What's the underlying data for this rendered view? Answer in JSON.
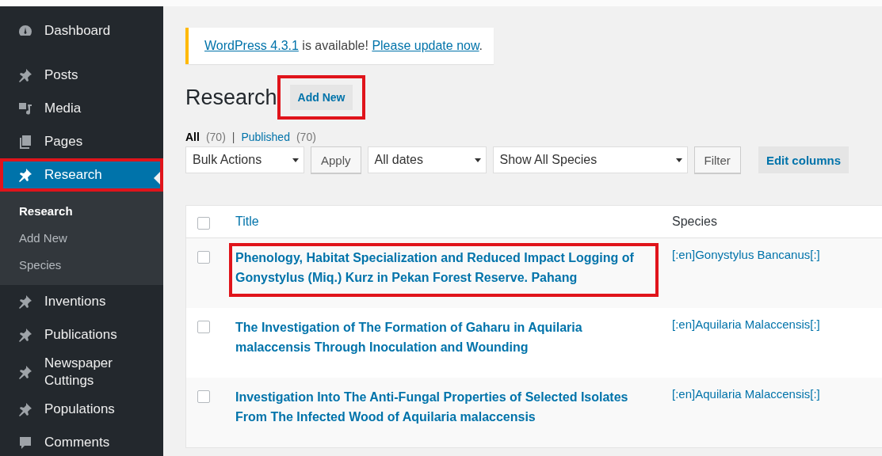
{
  "sidebar": {
    "items": [
      {
        "label": "Dashboard",
        "kind": "dashboard",
        "selected": false,
        "highlighted": false
      },
      {
        "label": "Posts",
        "kind": "pin",
        "selected": false,
        "highlighted": false
      },
      {
        "label": "Media",
        "kind": "media",
        "selected": false,
        "highlighted": false
      },
      {
        "label": "Pages",
        "kind": "pages",
        "selected": false,
        "highlighted": false
      },
      {
        "label": "Research",
        "kind": "pin",
        "selected": true,
        "highlighted": true,
        "submenu": [
          {
            "label": "Research",
            "selected": true
          },
          {
            "label": "Add New",
            "selected": false
          },
          {
            "label": "Species",
            "selected": false
          }
        ]
      },
      {
        "label": "Inventions",
        "kind": "pin",
        "selected": false,
        "highlighted": false
      },
      {
        "label": "Publications",
        "kind": "pin",
        "selected": false,
        "highlighted": false
      },
      {
        "label": "Newspaper Cuttings",
        "kind": "pin",
        "selected": false,
        "highlighted": false
      },
      {
        "label": "Populations",
        "kind": "pin",
        "selected": false,
        "highlighted": false
      },
      {
        "label": "Comments",
        "kind": "comment",
        "selected": false,
        "highlighted": false
      }
    ]
  },
  "notice": {
    "parts": [
      {
        "kind": "link",
        "text": "WordPress 4.3.1"
      },
      {
        "kind": "text",
        "text": " is available! "
      },
      {
        "kind": "link",
        "text": "Please update now"
      },
      {
        "kind": "text",
        "text": "."
      }
    ]
  },
  "page_title": "Research",
  "add_new": {
    "label": "Add New",
    "highlighted": true
  },
  "views": [
    {
      "label": "All",
      "count": "(70)",
      "selected": true
    },
    {
      "label": "Published",
      "count": "(70)",
      "selected": false
    }
  ],
  "view_separator": "|",
  "toolbar": [
    {
      "kind": "select",
      "label": "Bulk Actions"
    },
    {
      "kind": "button",
      "label": "Apply"
    },
    {
      "kind": "select",
      "label": "All dates"
    },
    {
      "kind": "select",
      "label": "Show All Species"
    },
    {
      "kind": "button",
      "label": "Filter"
    },
    {
      "kind": "flat",
      "label": "Edit columns"
    }
  ],
  "table": {
    "columns": [
      {
        "label": "Title"
      },
      {
        "label": "Species"
      }
    ],
    "header_checked": false,
    "rows": [
      {
        "title": "Phenology, Habitat Specialization and Reduced Impact Logging of Gonystylus (Miq.) Kurz in Pekan Forest Reserve. Pahang",
        "species": "[:en]Gonystylus Bancanus[:]",
        "checked": false,
        "highlighted": true
      },
      {
        "title": "The Investigation of The Formation of Gaharu in Aquilaria malaccensis Through Inoculation and Wounding",
        "species": "[:en]Aquilaria Malaccensis[:]",
        "checked": false,
        "highlighted": false
      },
      {
        "title": "Investigation Into The Anti-Fungal Properties of Selected Isolates From The Infected Wood of Aquilaria malaccensis",
        "species": "[:en]Aquilaria Malaccensis[:]",
        "checked": false,
        "highlighted": false
      }
    ]
  }
}
